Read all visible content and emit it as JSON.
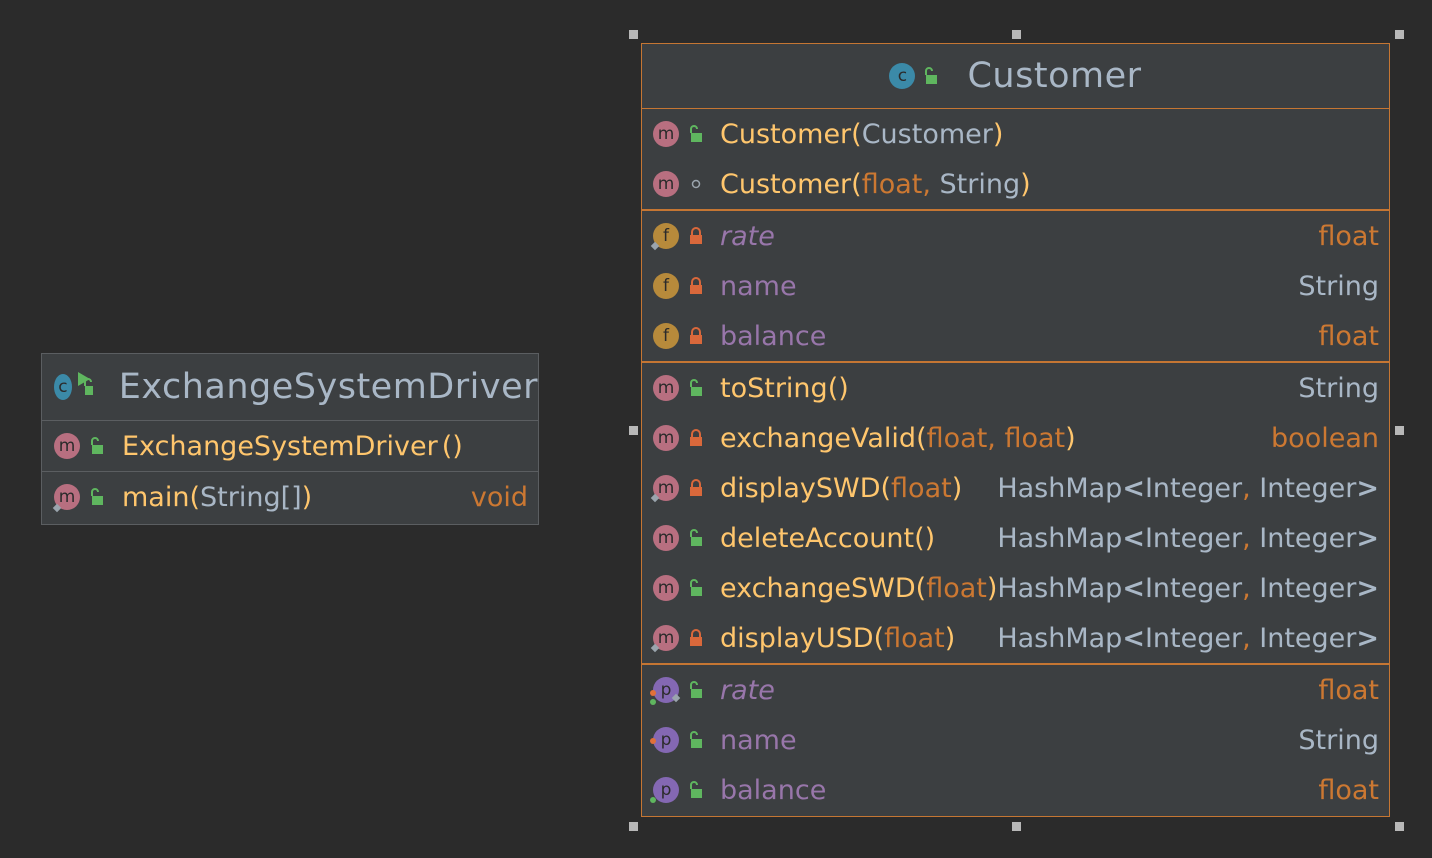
{
  "diagram": {
    "driver": {
      "title": "ExchangeSystemDriver",
      "constructors": [
        {
          "name": "ExchangeSystemDriver",
          "params": "()"
        }
      ],
      "methods": [
        {
          "name": "main",
          "open": "(",
          "params": "String[]",
          "close": ")",
          "type": "void"
        }
      ]
    },
    "customer": {
      "title": "Customer",
      "constructors": [
        {
          "name": "Customer",
          "open": "(",
          "params": "Customer",
          "close": ")"
        },
        {
          "name": "Customer",
          "open": "(",
          "p1": "float",
          "sep": ", ",
          "p2": "String",
          "close": ")"
        }
      ],
      "fields": [
        {
          "name": "rate",
          "type": "float"
        },
        {
          "name": "name",
          "type": "String"
        },
        {
          "name": "balance",
          "type": "float"
        }
      ],
      "methods": [
        {
          "name": "toString",
          "params": "()",
          "type": "String"
        },
        {
          "name": "exchangeValid",
          "open": "(",
          "p1": "float",
          "sep": ", ",
          "p2": "float",
          "close": ")",
          "type": "boolean"
        },
        {
          "name": "displaySWD",
          "open": "(",
          "p1": "float",
          "close": ")",
          "t_a": "HashMap",
          "t_lt": "<",
          "t_b": "Integer",
          "t_sep": ", ",
          "t_c": "Integer",
          "t_gt": ">"
        },
        {
          "name": "deleteAccount",
          "params": "()",
          "t_a": "HashMap",
          "t_lt": "<",
          "t_b": "Integer",
          "t_sep": ", ",
          "t_c": "Integer",
          "t_gt": ">"
        },
        {
          "name": "exchangeSWD",
          "open": "(",
          "p1": "float",
          "close": ")",
          "t_a": "HashMap",
          "t_lt": "<",
          "t_b": "Integer",
          "t_sep": ", ",
          "t_c": "Integer",
          "t_gt": ">"
        },
        {
          "name": "displayUSD",
          "open": "(",
          "p1": "float",
          "close": ")",
          "t_a": "HashMap",
          "t_lt": "<",
          "t_b": "Integer",
          "t_sep": ", ",
          "t_c": "Integer",
          "t_gt": ">"
        }
      ],
      "properties": [
        {
          "name": "rate",
          "type": "float"
        },
        {
          "name": "name",
          "type": "String"
        },
        {
          "name": "balance",
          "type": "float"
        }
      ]
    },
    "badges": {
      "class": "c",
      "method": "m",
      "field": "f",
      "property": "p"
    },
    "icons": {
      "class": "class-icon",
      "method": "method-icon",
      "field": "field-icon",
      "property": "property-icon",
      "public": "public-unlock-icon",
      "private": "private-lock-icon",
      "package": "package-private-dot-icon",
      "static": "static-diamond-icon"
    },
    "colors": {
      "background": "#2b2b2b",
      "panel": "#3c3f41",
      "selection_border": "#c57633",
      "method_name": "#ffc66d",
      "keyword": "#cc7832",
      "field_name": "#9876aa",
      "text": "#a9b7c6"
    }
  }
}
